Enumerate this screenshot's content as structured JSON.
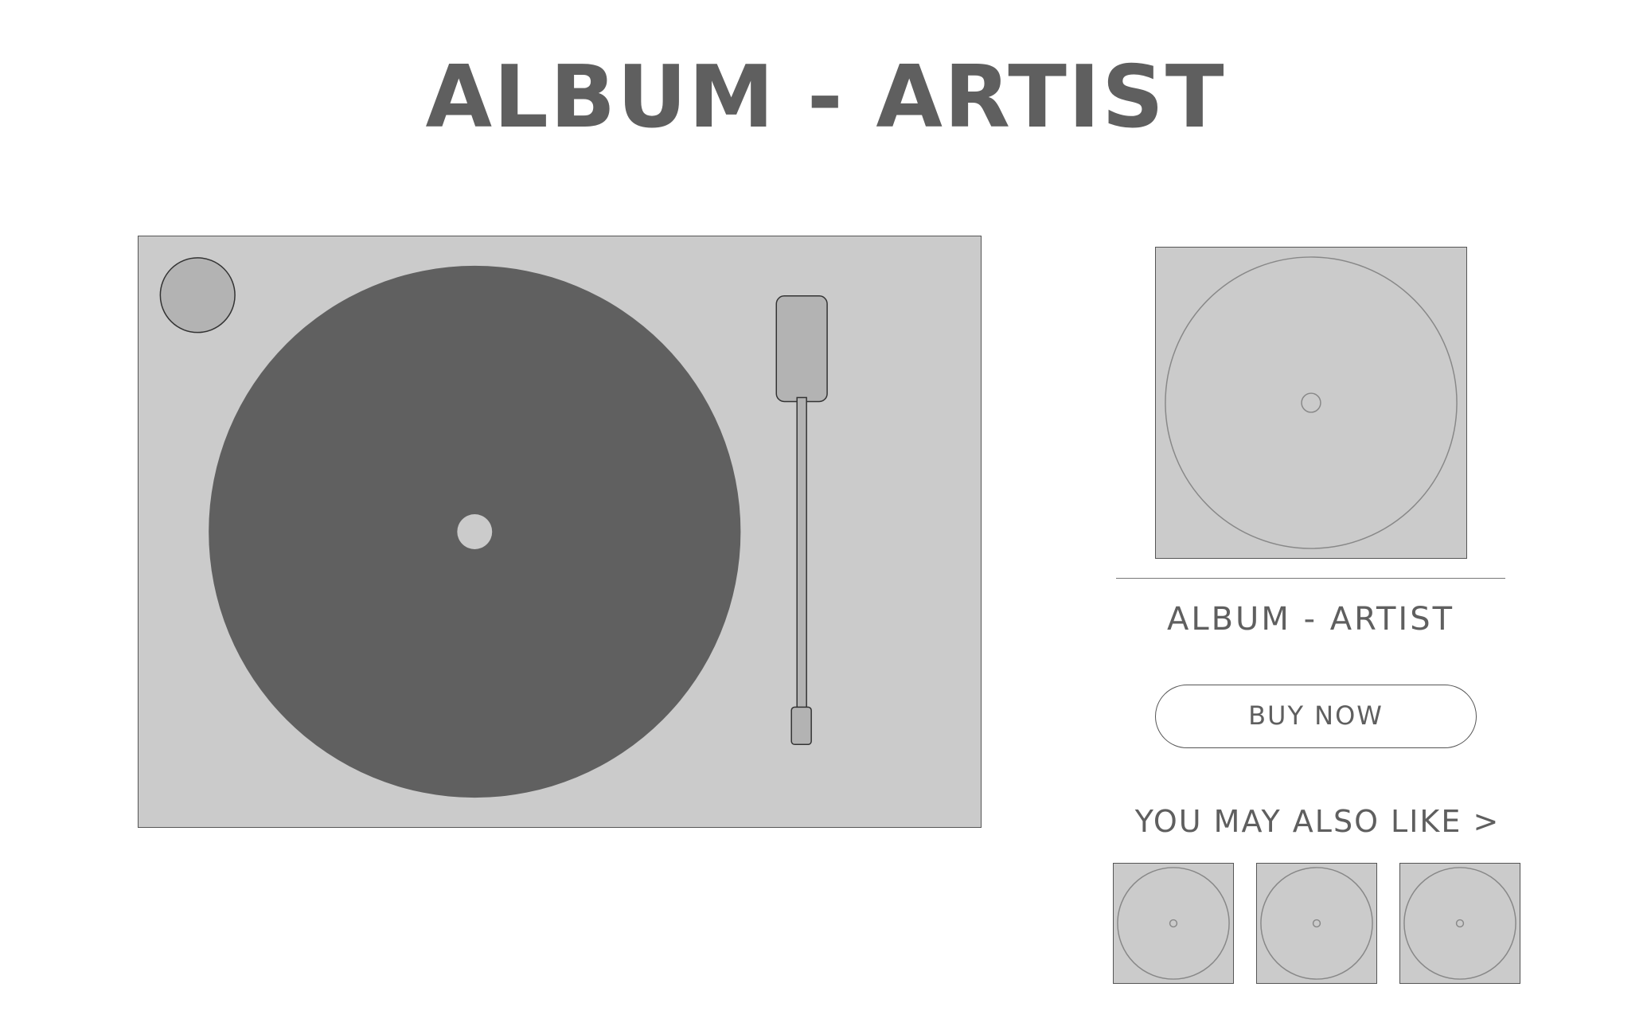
{
  "header": {
    "title": "ALBUM - ARTIST"
  },
  "player": {
    "turntable": "turntable",
    "record": "vinyl-record",
    "tonearm": "tonearm"
  },
  "sidebar": {
    "album_label": "ALBUM - ARTIST",
    "buy_button_label": "BUY NOW",
    "also_like_label": "YOU MAY ALSO LIKE >",
    "recommendations": [
      "album-cover-1",
      "album-cover-2",
      "album-cover-3"
    ]
  },
  "colors": {
    "text": "#5f5f5f",
    "panel": "#cbcbcb",
    "record": "#606060",
    "knob": "#b3b3b3",
    "outline": "#555555"
  }
}
